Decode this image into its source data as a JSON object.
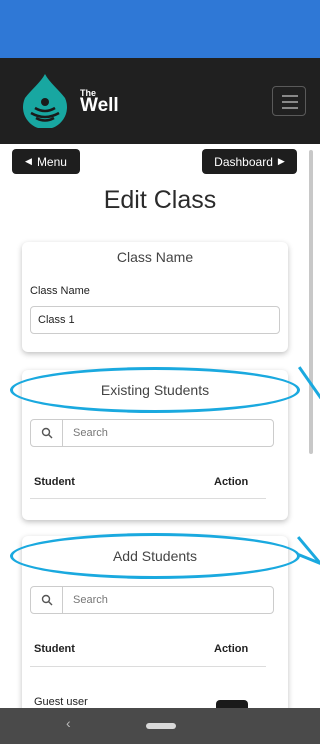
{
  "brand": {
    "small": "The",
    "name": "Well"
  },
  "nav": {
    "menu_label": "Menu",
    "dashboard_label": "Dashboard"
  },
  "page": {
    "title": "Edit Class"
  },
  "class_card": {
    "title": "Class Name",
    "label": "Class Name",
    "value": "Class 1"
  },
  "existing_card": {
    "title": "Existing Students",
    "search_placeholder": "Search",
    "columns": [
      "Student",
      "Action"
    ]
  },
  "add_card": {
    "title": "Add Students",
    "search_placeholder": "Search",
    "columns": [
      "Student",
      "Action"
    ],
    "rows": [
      {
        "student": "Guest user"
      }
    ]
  },
  "colors": {
    "accent": "#1aa9df",
    "brand_teal": "#18a7a1",
    "status_bar": "#2f78d6",
    "navbar": "#202020"
  },
  "icons": [
    "logo-icon",
    "hamburger-icon",
    "caret-left-icon",
    "caret-right-icon",
    "search-icon",
    "back-icon",
    "home-pill-icon"
  ]
}
